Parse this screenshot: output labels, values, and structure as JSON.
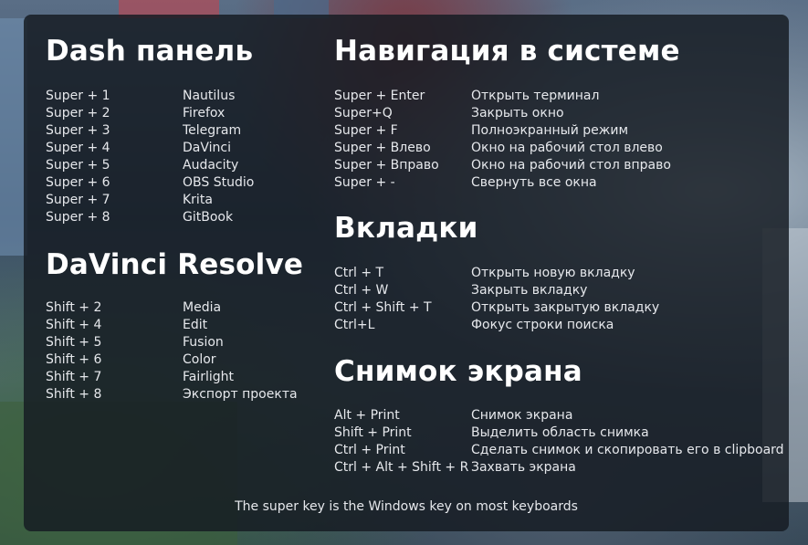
{
  "dash": {
    "title": "Dash панель",
    "items": [
      {
        "key": "Super + 1",
        "action": "Nautilus"
      },
      {
        "key": "Super + 2",
        "action": "Firefox"
      },
      {
        "key": "Super + 3",
        "action": "Telegram"
      },
      {
        "key": "Super + 4",
        "action": "DaVinci"
      },
      {
        "key": "Super + 5",
        "action": "Audacity"
      },
      {
        "key": "Super + 6",
        "action": "OBS Studio"
      },
      {
        "key": "Super + 7",
        "action": "Krita"
      },
      {
        "key": "Super + 8",
        "action": "GitBook"
      }
    ]
  },
  "davinci": {
    "title": "DaVinci Resolve",
    "items": [
      {
        "key": "Shift + 2",
        "action": "Media"
      },
      {
        "key": "Shift + 4",
        "action": "Edit"
      },
      {
        "key": "Shift + 5",
        "action": "Fusion"
      },
      {
        "key": "Shift + 6",
        "action": "Color"
      },
      {
        "key": "Shift + 7",
        "action": "Fairlight"
      },
      {
        "key": "Shift + 8",
        "action": "Экспорт проекта"
      }
    ]
  },
  "navigation": {
    "title": "Навигация в системе",
    "items": [
      {
        "key": "Super + Enter",
        "action": "Открыть терминал"
      },
      {
        "key": "Super+Q",
        "action": "Закрыть окно"
      },
      {
        "key": "Super + F",
        "action": "Полноэкранный режим"
      },
      {
        "key": "Super + Влево",
        "action": "Окно на рабочий стол влево"
      },
      {
        "key": "Super + Вправо",
        "action": "Окно на рабочий стол вправо"
      },
      {
        "key": "Super + -",
        "action": "Свернуть все окна"
      }
    ]
  },
  "tabs": {
    "title": "Вкладки",
    "items": [
      {
        "key": "Ctrl + T",
        "action": "Открыть новую вкладку"
      },
      {
        "key": "Ctrl + W",
        "action": "Закрыть вкладку"
      },
      {
        "key": "Ctrl + Shift + T",
        "action": "Открыть закрытую вкладку"
      },
      {
        "key": "Ctrl+L",
        "action": "Фокус строки поиска"
      }
    ]
  },
  "screenshot": {
    "title": "Снимок экрана",
    "items": [
      {
        "key": "Alt + Print",
        "action": "Снимок экрана"
      },
      {
        "key": "Shift + Print",
        "action": "Выделить область снимка"
      },
      {
        "key": "Ctrl + Print",
        "action": "Сделать снимок и скопировать его в clipboard"
      },
      {
        "key": "Ctrl + Alt + Shift + R",
        "action": "Захвать экрана"
      }
    ]
  },
  "footer": "The super key is the Windows key on most keyboards"
}
